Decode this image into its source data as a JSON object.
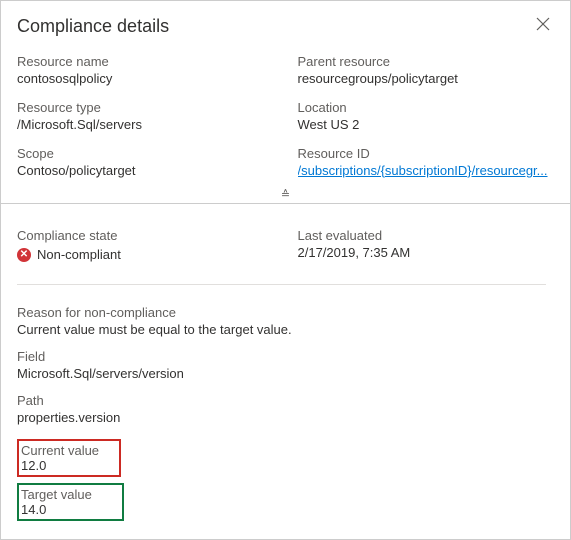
{
  "header": {
    "title": "Compliance details"
  },
  "props": {
    "resource_name": {
      "label": "Resource name",
      "value": "contososqlpolicy"
    },
    "parent_resource": {
      "label": "Parent resource",
      "value": "resourcegroups/policytarget"
    },
    "resource_type": {
      "label": "Resource type",
      "value": "/Microsoft.Sql/servers"
    },
    "location": {
      "label": "Location",
      "value": "West US 2"
    },
    "scope": {
      "label": "Scope",
      "value": "Contoso/policytarget"
    },
    "resource_id": {
      "label": "Resource ID",
      "value": "/subscriptions/{subscriptionID}/resourcegr..."
    }
  },
  "compliance": {
    "state": {
      "label": "Compliance state",
      "value": "Non-compliant"
    },
    "evaluated": {
      "label": "Last evaluated",
      "value": "2/17/2019, 7:35 AM"
    }
  },
  "reason": {
    "title": "Reason for non-compliance",
    "text": "Current value must be equal to the target value.",
    "field": {
      "label": "Field",
      "value": "Microsoft.Sql/servers/version"
    },
    "path": {
      "label": "Path",
      "value": "properties.version"
    },
    "current": {
      "label": "Current value",
      "value": "12.0"
    },
    "target": {
      "label": "Target value",
      "value": "14.0"
    }
  }
}
